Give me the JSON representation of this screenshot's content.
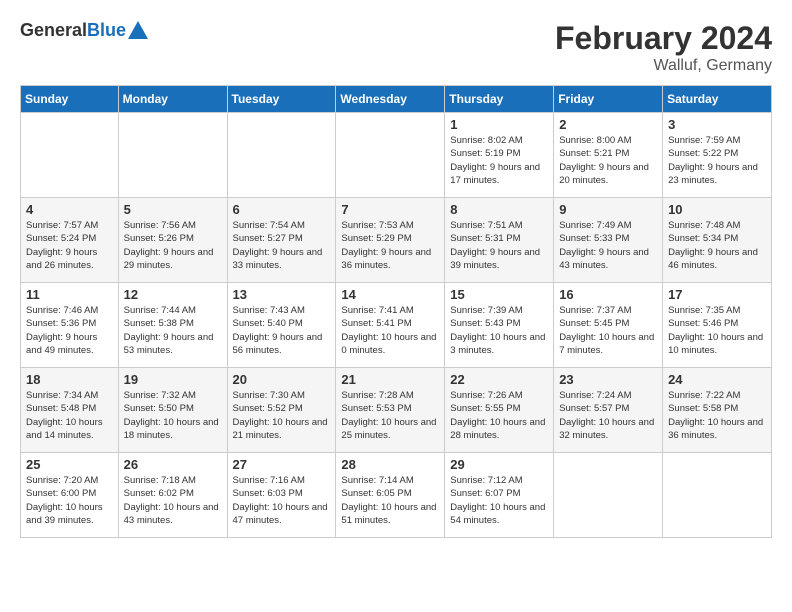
{
  "header": {
    "logo": {
      "general": "General",
      "blue": "Blue"
    },
    "title": "February 2024",
    "location": "Walluf, Germany"
  },
  "weekdays": [
    "Sunday",
    "Monday",
    "Tuesday",
    "Wednesday",
    "Thursday",
    "Friday",
    "Saturday"
  ],
  "weeks": [
    [
      {
        "day": "",
        "sunrise": "",
        "sunset": "",
        "daylight": ""
      },
      {
        "day": "",
        "sunrise": "",
        "sunset": "",
        "daylight": ""
      },
      {
        "day": "",
        "sunrise": "",
        "sunset": "",
        "daylight": ""
      },
      {
        "day": "",
        "sunrise": "",
        "sunset": "",
        "daylight": ""
      },
      {
        "day": "1",
        "sunrise": "Sunrise: 8:02 AM",
        "sunset": "Sunset: 5:19 PM",
        "daylight": "Daylight: 9 hours and 17 minutes."
      },
      {
        "day": "2",
        "sunrise": "Sunrise: 8:00 AM",
        "sunset": "Sunset: 5:21 PM",
        "daylight": "Daylight: 9 hours and 20 minutes."
      },
      {
        "day": "3",
        "sunrise": "Sunrise: 7:59 AM",
        "sunset": "Sunset: 5:22 PM",
        "daylight": "Daylight: 9 hours and 23 minutes."
      }
    ],
    [
      {
        "day": "4",
        "sunrise": "Sunrise: 7:57 AM",
        "sunset": "Sunset: 5:24 PM",
        "daylight": "Daylight: 9 hours and 26 minutes."
      },
      {
        "day": "5",
        "sunrise": "Sunrise: 7:56 AM",
        "sunset": "Sunset: 5:26 PM",
        "daylight": "Daylight: 9 hours and 29 minutes."
      },
      {
        "day": "6",
        "sunrise": "Sunrise: 7:54 AM",
        "sunset": "Sunset: 5:27 PM",
        "daylight": "Daylight: 9 hours and 33 minutes."
      },
      {
        "day": "7",
        "sunrise": "Sunrise: 7:53 AM",
        "sunset": "Sunset: 5:29 PM",
        "daylight": "Daylight: 9 hours and 36 minutes."
      },
      {
        "day": "8",
        "sunrise": "Sunrise: 7:51 AM",
        "sunset": "Sunset: 5:31 PM",
        "daylight": "Daylight: 9 hours and 39 minutes."
      },
      {
        "day": "9",
        "sunrise": "Sunrise: 7:49 AM",
        "sunset": "Sunset: 5:33 PM",
        "daylight": "Daylight: 9 hours and 43 minutes."
      },
      {
        "day": "10",
        "sunrise": "Sunrise: 7:48 AM",
        "sunset": "Sunset: 5:34 PM",
        "daylight": "Daylight: 9 hours and 46 minutes."
      }
    ],
    [
      {
        "day": "11",
        "sunrise": "Sunrise: 7:46 AM",
        "sunset": "Sunset: 5:36 PM",
        "daylight": "Daylight: 9 hours and 49 minutes."
      },
      {
        "day": "12",
        "sunrise": "Sunrise: 7:44 AM",
        "sunset": "Sunset: 5:38 PM",
        "daylight": "Daylight: 9 hours and 53 minutes."
      },
      {
        "day": "13",
        "sunrise": "Sunrise: 7:43 AM",
        "sunset": "Sunset: 5:40 PM",
        "daylight": "Daylight: 9 hours and 56 minutes."
      },
      {
        "day": "14",
        "sunrise": "Sunrise: 7:41 AM",
        "sunset": "Sunset: 5:41 PM",
        "daylight": "Daylight: 10 hours and 0 minutes."
      },
      {
        "day": "15",
        "sunrise": "Sunrise: 7:39 AM",
        "sunset": "Sunset: 5:43 PM",
        "daylight": "Daylight: 10 hours and 3 minutes."
      },
      {
        "day": "16",
        "sunrise": "Sunrise: 7:37 AM",
        "sunset": "Sunset: 5:45 PM",
        "daylight": "Daylight: 10 hours and 7 minutes."
      },
      {
        "day": "17",
        "sunrise": "Sunrise: 7:35 AM",
        "sunset": "Sunset: 5:46 PM",
        "daylight": "Daylight: 10 hours and 10 minutes."
      }
    ],
    [
      {
        "day": "18",
        "sunrise": "Sunrise: 7:34 AM",
        "sunset": "Sunset: 5:48 PM",
        "daylight": "Daylight: 10 hours and 14 minutes."
      },
      {
        "day": "19",
        "sunrise": "Sunrise: 7:32 AM",
        "sunset": "Sunset: 5:50 PM",
        "daylight": "Daylight: 10 hours and 18 minutes."
      },
      {
        "day": "20",
        "sunrise": "Sunrise: 7:30 AM",
        "sunset": "Sunset: 5:52 PM",
        "daylight": "Daylight: 10 hours and 21 minutes."
      },
      {
        "day": "21",
        "sunrise": "Sunrise: 7:28 AM",
        "sunset": "Sunset: 5:53 PM",
        "daylight": "Daylight: 10 hours and 25 minutes."
      },
      {
        "day": "22",
        "sunrise": "Sunrise: 7:26 AM",
        "sunset": "Sunset: 5:55 PM",
        "daylight": "Daylight: 10 hours and 28 minutes."
      },
      {
        "day": "23",
        "sunrise": "Sunrise: 7:24 AM",
        "sunset": "Sunset: 5:57 PM",
        "daylight": "Daylight: 10 hours and 32 minutes."
      },
      {
        "day": "24",
        "sunrise": "Sunrise: 7:22 AM",
        "sunset": "Sunset: 5:58 PM",
        "daylight": "Daylight: 10 hours and 36 minutes."
      }
    ],
    [
      {
        "day": "25",
        "sunrise": "Sunrise: 7:20 AM",
        "sunset": "Sunset: 6:00 PM",
        "daylight": "Daylight: 10 hours and 39 minutes."
      },
      {
        "day": "26",
        "sunrise": "Sunrise: 7:18 AM",
        "sunset": "Sunset: 6:02 PM",
        "daylight": "Daylight: 10 hours and 43 minutes."
      },
      {
        "day": "27",
        "sunrise": "Sunrise: 7:16 AM",
        "sunset": "Sunset: 6:03 PM",
        "daylight": "Daylight: 10 hours and 47 minutes."
      },
      {
        "day": "28",
        "sunrise": "Sunrise: 7:14 AM",
        "sunset": "Sunset: 6:05 PM",
        "daylight": "Daylight: 10 hours and 51 minutes."
      },
      {
        "day": "29",
        "sunrise": "Sunrise: 7:12 AM",
        "sunset": "Sunset: 6:07 PM",
        "daylight": "Daylight: 10 hours and 54 minutes."
      },
      {
        "day": "",
        "sunrise": "",
        "sunset": "",
        "daylight": ""
      },
      {
        "day": "",
        "sunrise": "",
        "sunset": "",
        "daylight": ""
      }
    ]
  ]
}
